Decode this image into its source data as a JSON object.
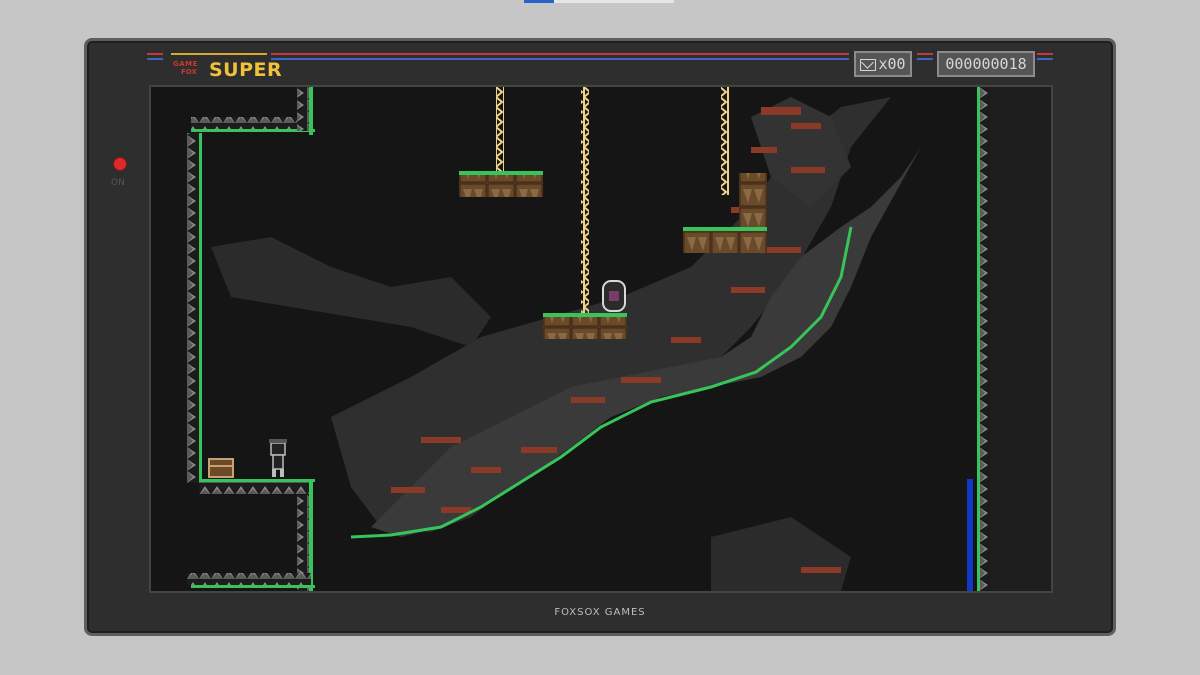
{
  "logo": {
    "line1": "GAME",
    "line2": "FOX",
    "main": "SUPER"
  },
  "hud": {
    "letter_count": "x00",
    "score": "000000018",
    "mail_icon": "envelope-icon"
  },
  "power": {
    "label": "ON",
    "led_color": "#e02a2a"
  },
  "footer": {
    "brand": "FOXSOX GAMES"
  },
  "colors": {
    "grass": "#37c45a",
    "rock": "#7a7a7a",
    "crate": "#6b4a2a",
    "chain": "#f0d28a",
    "water": "#1238c8",
    "cave_moss": "#8a3a26"
  }
}
